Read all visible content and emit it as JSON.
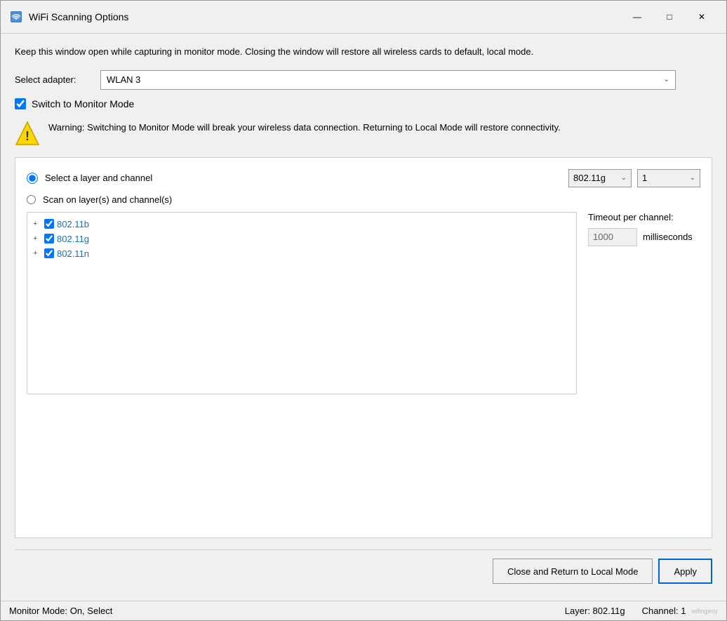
{
  "window": {
    "title": "WiFi Scanning Options",
    "icon": "wifi-icon"
  },
  "titlebar": {
    "minimize_label": "—",
    "maximize_label": "□",
    "close_label": "✕"
  },
  "info": {
    "text": "Keep this window open while capturing in monitor mode. Closing the window will restore all wireless cards to default, local mode."
  },
  "adapter": {
    "label": "Select adapter:",
    "value": "WLAN 3"
  },
  "monitor_mode": {
    "label": "Switch to Monitor Mode",
    "checked": true
  },
  "warning": {
    "text": "Warning: Switching to Monitor Mode will break your wireless data connection. Returning to Local Mode will restore connectivity."
  },
  "radio_options": {
    "select_layer": {
      "label": "Select a layer and channel",
      "checked": true
    },
    "scan_layers": {
      "label": "Scan on layer(s) and channel(s)",
      "checked": false
    }
  },
  "layer_dropdown": {
    "value": "802.11g"
  },
  "channel_dropdown": {
    "value": "1"
  },
  "channel_list": {
    "items": [
      {
        "id": "802_11b",
        "label": "802.11b",
        "checked": true
      },
      {
        "id": "802_11g",
        "label": "802.11g",
        "checked": true
      },
      {
        "id": "802_11n",
        "label": "802.11n",
        "checked": true
      }
    ]
  },
  "timeout": {
    "label": "Timeout per channel:",
    "value": "1000",
    "unit": "milliseconds"
  },
  "buttons": {
    "close_local": "Close and Return to Local Mode",
    "apply": "Apply"
  },
  "status": {
    "left": "Monitor Mode: On, Select",
    "layer": "Layer: 802.11g",
    "channel": "Channel: 1"
  }
}
